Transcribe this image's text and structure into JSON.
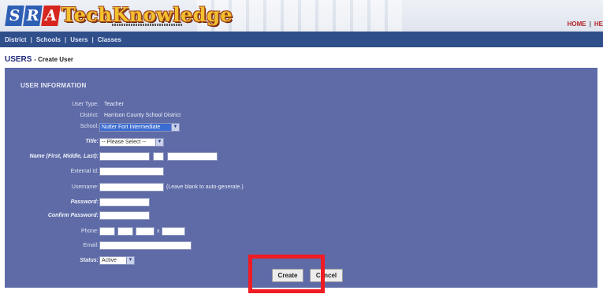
{
  "header": {
    "logo_letters": [
      "S",
      "R",
      "A"
    ],
    "logo_name": "TechKnowledge",
    "links": [
      "HOME",
      "HE"
    ]
  },
  "nav": {
    "items": [
      "District",
      "Schools",
      "Users",
      "Classes"
    ],
    "separator": "|"
  },
  "page": {
    "title": "USERS",
    "subtitle": "- Create User"
  },
  "form": {
    "heading": "USER INFORMATION",
    "user_type": {
      "label": "User Type:",
      "value": "Teacher"
    },
    "district": {
      "label": "District:",
      "value": "Harrison County School District"
    },
    "school": {
      "label": "School:",
      "value": "Nutter Fort Intermediate"
    },
    "title": {
      "label": "Title:",
      "value": "-- Please Select --"
    },
    "name": {
      "label": "Name (First, Middle, Last):",
      "first": "",
      "middle": "",
      "last": ""
    },
    "external_id": {
      "label": "External Id:",
      "value": ""
    },
    "username": {
      "label": "Username:",
      "value": "",
      "hint": "(Leave blank to auto-generate.)"
    },
    "password": {
      "label": "Password:",
      "value": ""
    },
    "confirm_password": {
      "label": "Confirm Password:",
      "value": ""
    },
    "phone": {
      "label": "Phone:",
      "ext_marker": "x"
    },
    "email": {
      "label": "Email:",
      "value": ""
    },
    "status": {
      "label": "Status:",
      "value": "Active"
    }
  },
  "buttons": {
    "create": "Create",
    "cancel": "Cancel"
  },
  "colors": {
    "panel": "#5e6ba7",
    "nav": "#2f4f8b",
    "annotation": "#ef1c24"
  }
}
